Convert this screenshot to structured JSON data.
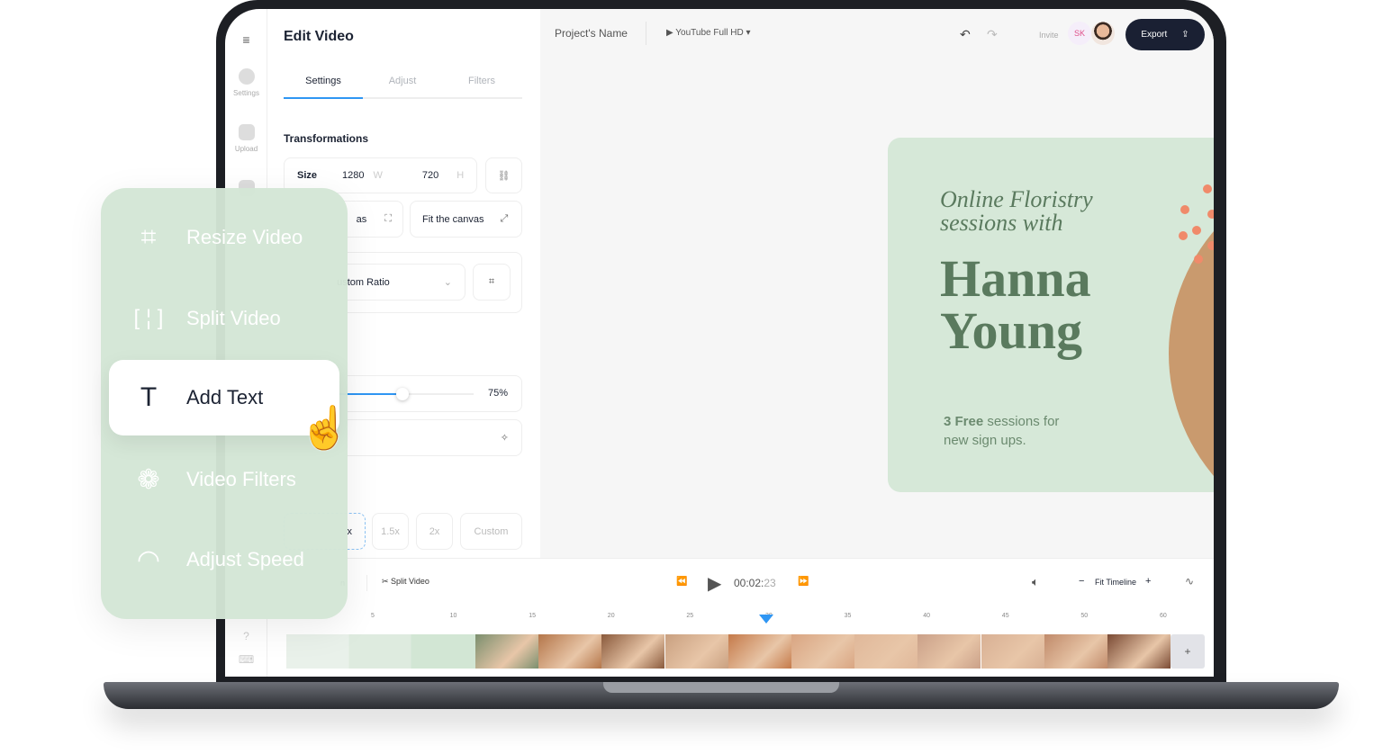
{
  "sidebar": {
    "items": [
      {
        "label": "Settings",
        "icon": "gear-icon"
      },
      {
        "label": "Upload",
        "icon": "image-icon"
      }
    ]
  },
  "panel": {
    "title": "Edit Video",
    "tabs": [
      "Settings",
      "Adjust",
      "Filters"
    ],
    "active_tab": "Settings",
    "section": "Transformations",
    "size_label": "Size",
    "width": "1280",
    "width_unit": "W",
    "height": "720",
    "height_unit": "H",
    "fill_partial": "as",
    "fit_label": "Fit the canvas",
    "ratio_partial": "ustom Ratio",
    "slider_value": 75,
    "slider_label": "75%",
    "effect_partial": ")",
    "speeds": [
      "x",
      "1.5x",
      "2x",
      "Custom"
    ]
  },
  "header": {
    "project_name": "Project's Name",
    "format": "YouTube Full HD",
    "invite": "Invite",
    "avatar_initials": "SK",
    "export": "Export"
  },
  "preview": {
    "line1": "Online Floristry",
    "line2": "sessions with",
    "name1": "Hanna",
    "name2": "Young",
    "promo_bold": "3 Free",
    "promo_rest": " sessions for",
    "promo_line2": "new sign ups."
  },
  "timeline": {
    "partial": "n",
    "split": "Split Video",
    "time_main": "00:02:",
    "time_frames": "23",
    "fit": "Fit Timeline",
    "ticks": [
      "5",
      "10",
      "15",
      "20",
      "25",
      "30",
      "35",
      "40",
      "45",
      "50",
      "60"
    ],
    "add": "+"
  },
  "menu": {
    "items": [
      {
        "label": "Resize Video",
        "icon": "crop-icon"
      },
      {
        "label": "Split Video",
        "icon": "split-icon"
      },
      {
        "label": "Add Text",
        "icon": "text-icon"
      },
      {
        "label": "Video Filters",
        "icon": "filters-icon"
      },
      {
        "label": "Adjust Speed",
        "icon": "speed-icon"
      }
    ],
    "active": "Add Text"
  },
  "colors": {
    "accent": "#2f96f3",
    "dark": "#1a2033",
    "card": "#d6e8d8",
    "text_green": "#5a7a5e"
  }
}
